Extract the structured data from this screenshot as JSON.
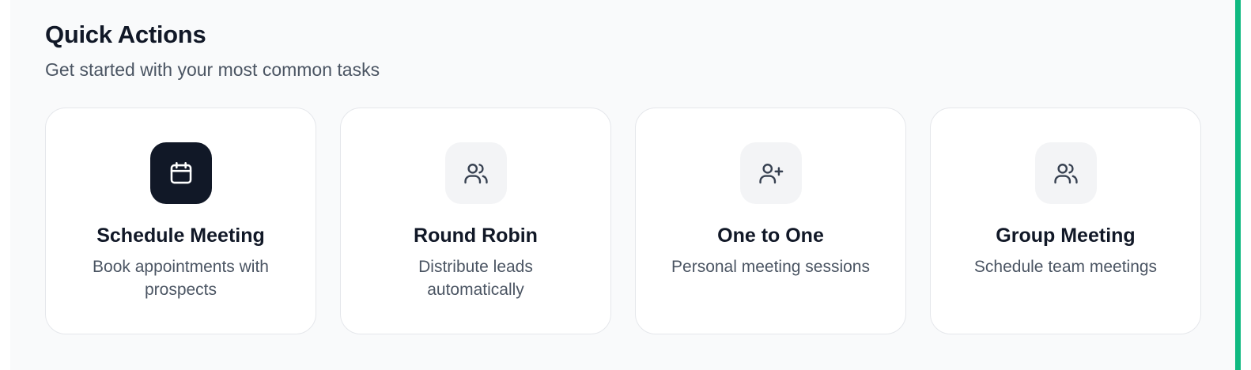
{
  "section": {
    "title": "Quick Actions",
    "subtitle": "Get started with your most common tasks"
  },
  "cards": [
    {
      "title": "Schedule Meeting",
      "description": "Book appointments with prospects",
      "icon": "calendar-icon",
      "active": true
    },
    {
      "title": "Round Robin",
      "description": "Distribute leads automatically",
      "icon": "users-icon",
      "active": false
    },
    {
      "title": "One to One",
      "description": "Personal meeting sessions",
      "icon": "user-plus-icon",
      "active": false
    },
    {
      "title": "Group Meeting",
      "description": "Schedule team meetings",
      "icon": "users-icon",
      "active": false
    }
  ],
  "colors": {
    "accent": "#10b981",
    "active_icon_bg": "#111827",
    "icon_bg": "#f3f4f6",
    "panel_bg": "#f9fafb"
  }
}
